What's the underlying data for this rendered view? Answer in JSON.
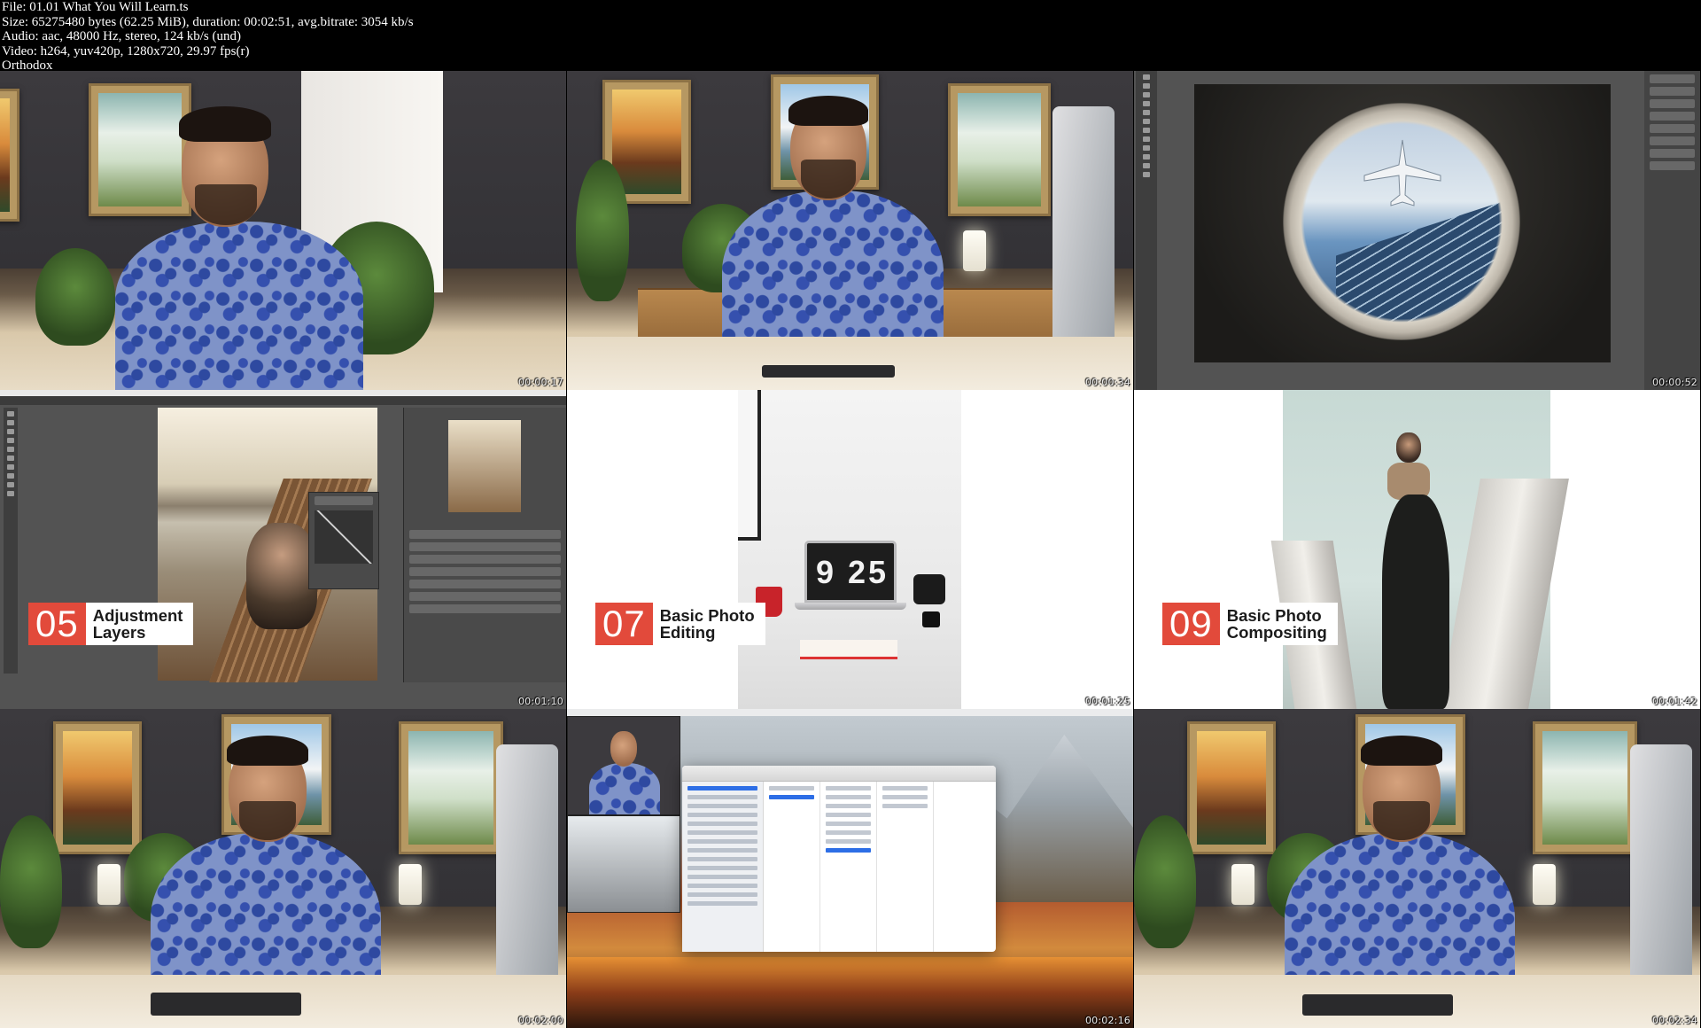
{
  "header": {
    "file_line": "File: 01.01 What You Will Learn.ts",
    "size_line": "Size: 65275480 bytes (62.25 MiB), duration: 00:02:51, avg.bitrate: 3054 kb/s",
    "audio_line": "Audio: aac, 48000 Hz, stereo, 124 kb/s (und)",
    "video_line": "Video: h264, yuv420p, 1280x720, 29.97 fps(r)",
    "credit_line": "Orthodox"
  },
  "thumbnails": [
    {
      "timestamp": "00:00:17"
    },
    {
      "timestamp": "00:00:34"
    },
    {
      "timestamp": "00:00:52"
    },
    {
      "timestamp": "00:01:10",
      "title_number": "05",
      "title_line1": "Adjustment",
      "title_line2": "Layers"
    },
    {
      "timestamp": "00:01:25",
      "title_number": "07",
      "title_line1": "Basic Photo",
      "title_line2": "Editing",
      "clock": "9 25"
    },
    {
      "timestamp": "00:01:42",
      "title_number": "09",
      "title_line1": "Basic Photo",
      "title_line2": "Compositing"
    },
    {
      "timestamp": "00:02:00"
    },
    {
      "timestamp": "00:02:16"
    },
    {
      "timestamp": "00:02:34"
    }
  ],
  "colors": {
    "title_number_bg": "#e24a3b",
    "title_text_bg": "#ffffff",
    "shirt_blue": "#7f93c8"
  }
}
